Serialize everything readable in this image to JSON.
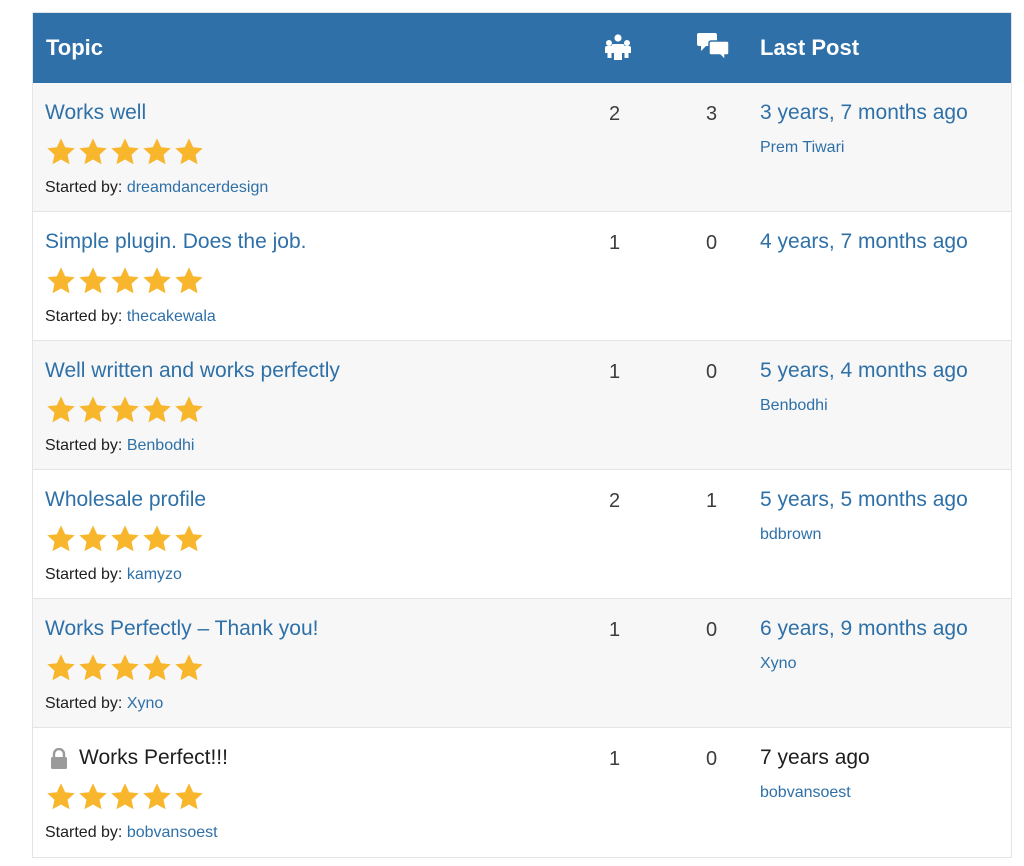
{
  "header": {
    "topic_label": "Topic",
    "voices_icon": "people-icon",
    "posts_icon": "speech-bubbles-icon",
    "last_post_label": "Last Post"
  },
  "colors": {
    "header_bg": "#2e70a7",
    "link": "#2e70a7",
    "star": "#f8b62d",
    "row_alt": "#f7f7f7"
  },
  "started_by_label": "Started by:",
  "topics": [
    {
      "title": "Works well",
      "rating": 5,
      "author": "dreamdancerdesign",
      "voices": "2",
      "posts": "3",
      "freshness": "3 years, 7 months ago",
      "last_author": "Prem Tiwari",
      "locked": false
    },
    {
      "title": "Simple plugin. Does the job.",
      "rating": 5,
      "author": "thecakewala",
      "voices": "1",
      "posts": "0",
      "freshness": "4 years, 7 months ago",
      "last_author": "",
      "locked": false
    },
    {
      "title": "Well written and works perfectly",
      "rating": 5,
      "author": "Benbodhi",
      "voices": "1",
      "posts": "0",
      "freshness": "5 years, 4 months ago",
      "last_author": "Benbodhi",
      "locked": false
    },
    {
      "title": "Wholesale profile",
      "rating": 5,
      "author": "kamyzo",
      "voices": "2",
      "posts": "1",
      "freshness": "5 years, 5 months ago",
      "last_author": "bdbrown",
      "locked": false
    },
    {
      "title": "Works Perfectly – Thank you!",
      "rating": 5,
      "author": "Xyno",
      "voices": "1",
      "posts": "0",
      "freshness": "6 years, 9 months ago",
      "last_author": "Xyno",
      "locked": false
    },
    {
      "title": "Works Perfect!!!",
      "rating": 5,
      "author": "bobvansoest",
      "voices": "1",
      "posts": "0",
      "freshness": "7 years ago",
      "last_author": "bobvansoest",
      "locked": true
    }
  ]
}
